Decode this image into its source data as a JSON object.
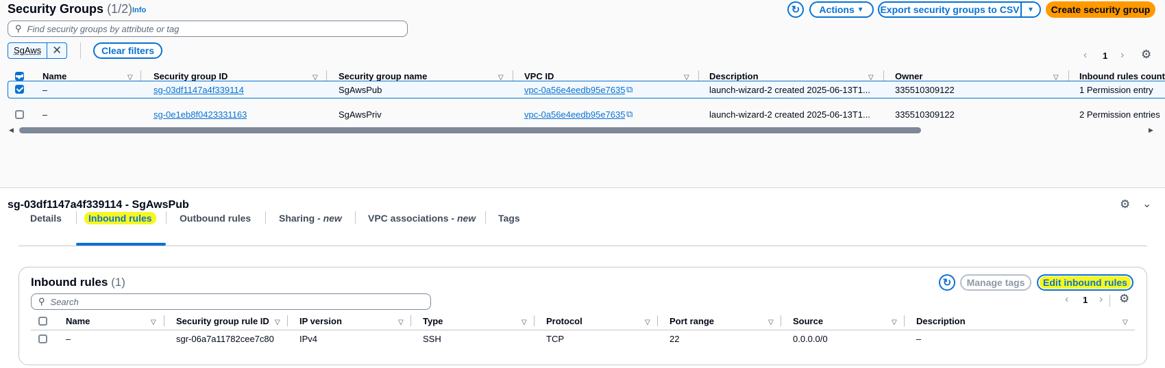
{
  "header": {
    "title": "Security Groups",
    "count": "(1/2)",
    "info": "Info"
  },
  "toolbar": {
    "actions_label": "Actions",
    "export_label": "Export security groups to CSV",
    "create_label": "Create security group"
  },
  "search": {
    "placeholder": "Find security groups by attribute or tag"
  },
  "filter": {
    "token": "SgAws",
    "clear_label": "Clear filters"
  },
  "pagination": {
    "page": "1"
  },
  "table": {
    "columns": [
      "Name",
      "Security group ID",
      "Security group name",
      "VPC ID",
      "Description",
      "Owner",
      "Inbound rules count"
    ],
    "rows": [
      {
        "name": "–",
        "id": "sg-03df1147a4f339114",
        "sg_name": "SgAwsPub",
        "vpc": "vpc-0a56e4eedb95e7635",
        "desc": "launch-wizard-2 created 2025-06-13T1...",
        "owner": "335510309122",
        "inbound": "1 Permission entry",
        "selected": true
      },
      {
        "name": "–",
        "id": "sg-0e1eb8f0423331163",
        "sg_name": "SgAwsPriv",
        "vpc": "vpc-0a56e4eedb95e7635",
        "desc": "launch-wizard-2 created 2025-06-13T1...",
        "owner": "335510309122",
        "inbound": "2 Permission entries",
        "selected": false
      }
    ]
  },
  "detail": {
    "title": "sg-03df1147a4f339114 - SgAwsPub",
    "tabs": [
      {
        "label": "Details"
      },
      {
        "label": "Inbound rules",
        "active": true
      },
      {
        "label": "Outbound rules"
      },
      {
        "label": "Sharing",
        "suffix": "new"
      },
      {
        "label": "VPC associations",
        "suffix": "new"
      },
      {
        "label": "Tags"
      }
    ],
    "tab_suffix_sep": " - "
  },
  "inbound": {
    "title": "Inbound rules",
    "count": "(1)",
    "manage_tags_label": "Manage tags",
    "edit_label": "Edit inbound rules",
    "search_placeholder": "Search",
    "page": "1",
    "columns": [
      "Name",
      "Security group rule ID",
      "IP version",
      "Type",
      "Protocol",
      "Port range",
      "Source",
      "Description"
    ],
    "rows": [
      {
        "name": "–",
        "rule_id": "sgr-06a7a11782cee7c80",
        "ip": "IPv4",
        "type": "SSH",
        "protocol": "TCP",
        "port": "22",
        "source": "0.0.0.0/0",
        "desc": "–"
      }
    ]
  },
  "colors": {
    "link": "#0972d3",
    "primary": "#ff9900",
    "highlight": "#f7f71f"
  }
}
